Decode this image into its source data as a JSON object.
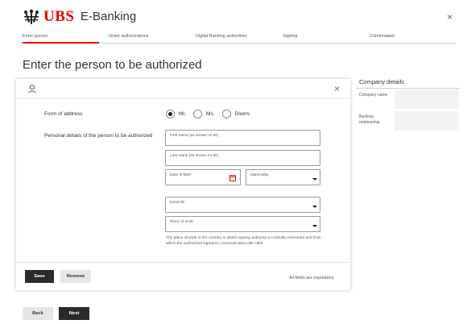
{
  "header": {
    "brand": "UBS",
    "app_title": "E-Banking",
    "close_symbol": "×",
    "logo_icon": "ubs-keys-icon"
  },
  "stepper": {
    "steps": [
      {
        "label": "Enter person",
        "active": true
      },
      {
        "label": "Grant authorizations",
        "active": false
      },
      {
        "label": "Digital Banking authorities",
        "active": false
      },
      {
        "label": "Signing",
        "active": false
      },
      {
        "label": "Confirmation",
        "active": false
      }
    ],
    "active_color": "#e60000"
  },
  "page": {
    "title": "Enter the person to be authorized"
  },
  "form": {
    "header_icon": "person-icon",
    "close_symbol": "×",
    "form_of_address_label": "Form of address",
    "address_options": [
      {
        "label": "Mr.",
        "checked": true
      },
      {
        "label": "Ms.",
        "checked": false
      },
      {
        "label": "Divers",
        "checked": false
      }
    ],
    "personal_details_label": "Personal details of the person to be authorized",
    "first_name_placeholder": "First name (as shown on ID)",
    "last_name_placeholder": "Last name (as shown on ID)",
    "dob_placeholder": "Date of birth",
    "nationality_placeholder": "Nationality",
    "domicile_placeholder": "Domicile",
    "place_of_work_placeholder": "Place of work",
    "place_of_work_note": "The place of work is the country in which signing authority is normally exercised and from which the authorized signatory communicates with UBS.",
    "save_label": "Save",
    "remove_label": "Remove",
    "mandatory_note": "All fields are mandatory."
  },
  "sidebar": {
    "title": "Company details",
    "rows": [
      {
        "label": "Company name",
        "value": ""
      },
      {
        "label": "Banking relationship",
        "value": ""
      }
    ]
  },
  "footer": {
    "back_label": "Back",
    "next_label": "Next"
  },
  "colors": {
    "brand_red": "#e60000",
    "button_dark": "#2b2b2b",
    "button_light": "#e6e6e6"
  }
}
